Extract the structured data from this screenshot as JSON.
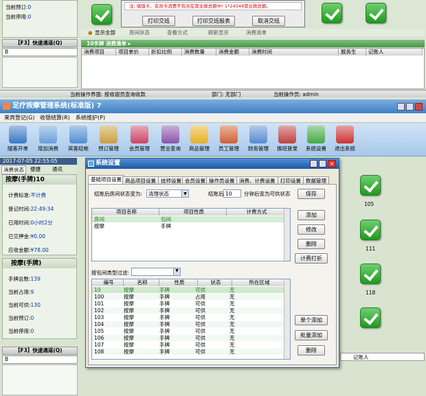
{
  "top_left": {
    "reserve_label": "当前预订:",
    "reserve_val": "0",
    "stop_label": "当前停用:",
    "stop_val": "0"
  },
  "quick_channel": "【F3】快速通道(Q)",
  "quick_input": "B",
  "dialog_top": {
    "note": "注: 储值卡、会员卡消费不包含在营业款总额中! 1*24344营业款总额。",
    "btn1": "打印交班",
    "btn2": "打印交班报表",
    "btn3": "取消交班"
  },
  "top_radio": {
    "show_all": "显示全部",
    "r2": "房间状态",
    "r3": "查看方式",
    "r4": "刷新显示",
    "r5": "消费清单"
  },
  "detail_title": "10手牌  消费清单 ▸",
  "detail_cols": [
    "消费项目",
    "项目单价",
    "折扣比例",
    "消费数量",
    "消费金额",
    "消费时间",
    "服务生",
    "记账人"
  ],
  "status_bar": {
    "iface": "当前操作界面: 按收银员查询收款",
    "dept": "部门: 无部门",
    "oper": "当前操作员: admin"
  },
  "main_title": "足疗按摩管理系统(标准版) 7",
  "menu": [
    "来宾登记(G)",
    "收银结算(R)",
    "系统维护(P)"
  ],
  "toolbar": [
    "随客开单",
    "增加消费",
    "宾客结帐",
    "预订管理",
    "会员管理",
    "营业查询",
    "商品管理",
    "员工管理",
    "财务管理",
    "换班登录",
    "系统设置",
    "退出系统"
  ],
  "toolbar_colors": [
    "#3b78c4",
    "#6aa0d8",
    "#4f8fd0",
    "#c8a040",
    "#cc4466",
    "#8855aa",
    "#e8b020",
    "#d06030",
    "#5a8ad0",
    "#c04040",
    "#44aa44",
    "#cc3333"
  ],
  "left_panel": {
    "date": "2017-07-05 22:55:05",
    "tabs": [
      "消费状态",
      "便捷",
      "通讯"
    ],
    "room_title": "按摩(手牌)10",
    "rows": [
      {
        "k": "计费标准:",
        "v": "不计费"
      },
      {
        "k": "登记时间:",
        "v": "22:49:34"
      },
      {
        "k": "已用时间:",
        "v": "0小时2分"
      },
      {
        "k": "已交押金:",
        "v": "¥0.00"
      },
      {
        "k": "应收金额:",
        "v": "¥78.00"
      }
    ],
    "stat_title": "按摩(手牌)",
    "stats": [
      {
        "k": "手牌总数:",
        "v": "139"
      },
      {
        "k": "当前占用:",
        "v": "9"
      },
      {
        "k": "当前可供:",
        "v": "130"
      },
      {
        "k": "当前预订:",
        "v": "0"
      },
      {
        "k": "当前停用:",
        "v": "0"
      }
    ]
  },
  "room_numbers": [
    "105",
    "111",
    "118"
  ],
  "dialog": {
    "title": "系统设置",
    "tabs": [
      "基础项目设置",
      "商品项目设置",
      "技师设置",
      "会员设置",
      "操作员设置",
      "消费、计费设置",
      "打印设置",
      "数据管理"
    ],
    "settle_label": "结账后房间状态变为:",
    "settle_val": "清理状态",
    "after_label": "结账后",
    "after_val": "10",
    "after_suffix": "分钟后变为可供状态",
    "save": "保存",
    "item_cols": [
      "项目名称",
      "项目性质",
      "计费方式"
    ],
    "items": [
      {
        "name": "房间",
        "kind": "包间",
        "mode": ""
      },
      {
        "name": "按摩",
        "kind": "手牌",
        "mode": ""
      }
    ],
    "btn_add": "添加",
    "btn_edit": "修改",
    "btn_del": "删除",
    "btn_calc": "计费打折",
    "filter_label": "按包间类型过滤:",
    "room_cols": [
      "编号",
      "名称",
      "性质",
      "状态",
      "所在区域"
    ],
    "rooms": [
      [
        "10",
        "按摩",
        "手牌",
        "可供",
        "无"
      ],
      [
        "100",
        "按摩",
        "手牌",
        "占用",
        "无"
      ],
      [
        "101",
        "按摩",
        "手牌",
        "可供",
        "无"
      ],
      [
        "102",
        "按摩",
        "手牌",
        "可供",
        "无"
      ],
      [
        "103",
        "按摩",
        "手牌",
        "可供",
        "无"
      ],
      [
        "104",
        "按摩",
        "手牌",
        "可供",
        "无"
      ],
      [
        "105",
        "按摩",
        "手牌",
        "可供",
        "无"
      ],
      [
        "106",
        "按摩",
        "手牌",
        "可供",
        "无"
      ],
      [
        "107",
        "按摩",
        "手牌",
        "可供",
        "无"
      ],
      [
        "108",
        "按摩",
        "手牌",
        "可供",
        "无"
      ]
    ],
    "btn_single": "单个添加",
    "btn_batch": "批量添加",
    "btn_del2": "删除"
  },
  "bottom_detail_col": "记账人"
}
